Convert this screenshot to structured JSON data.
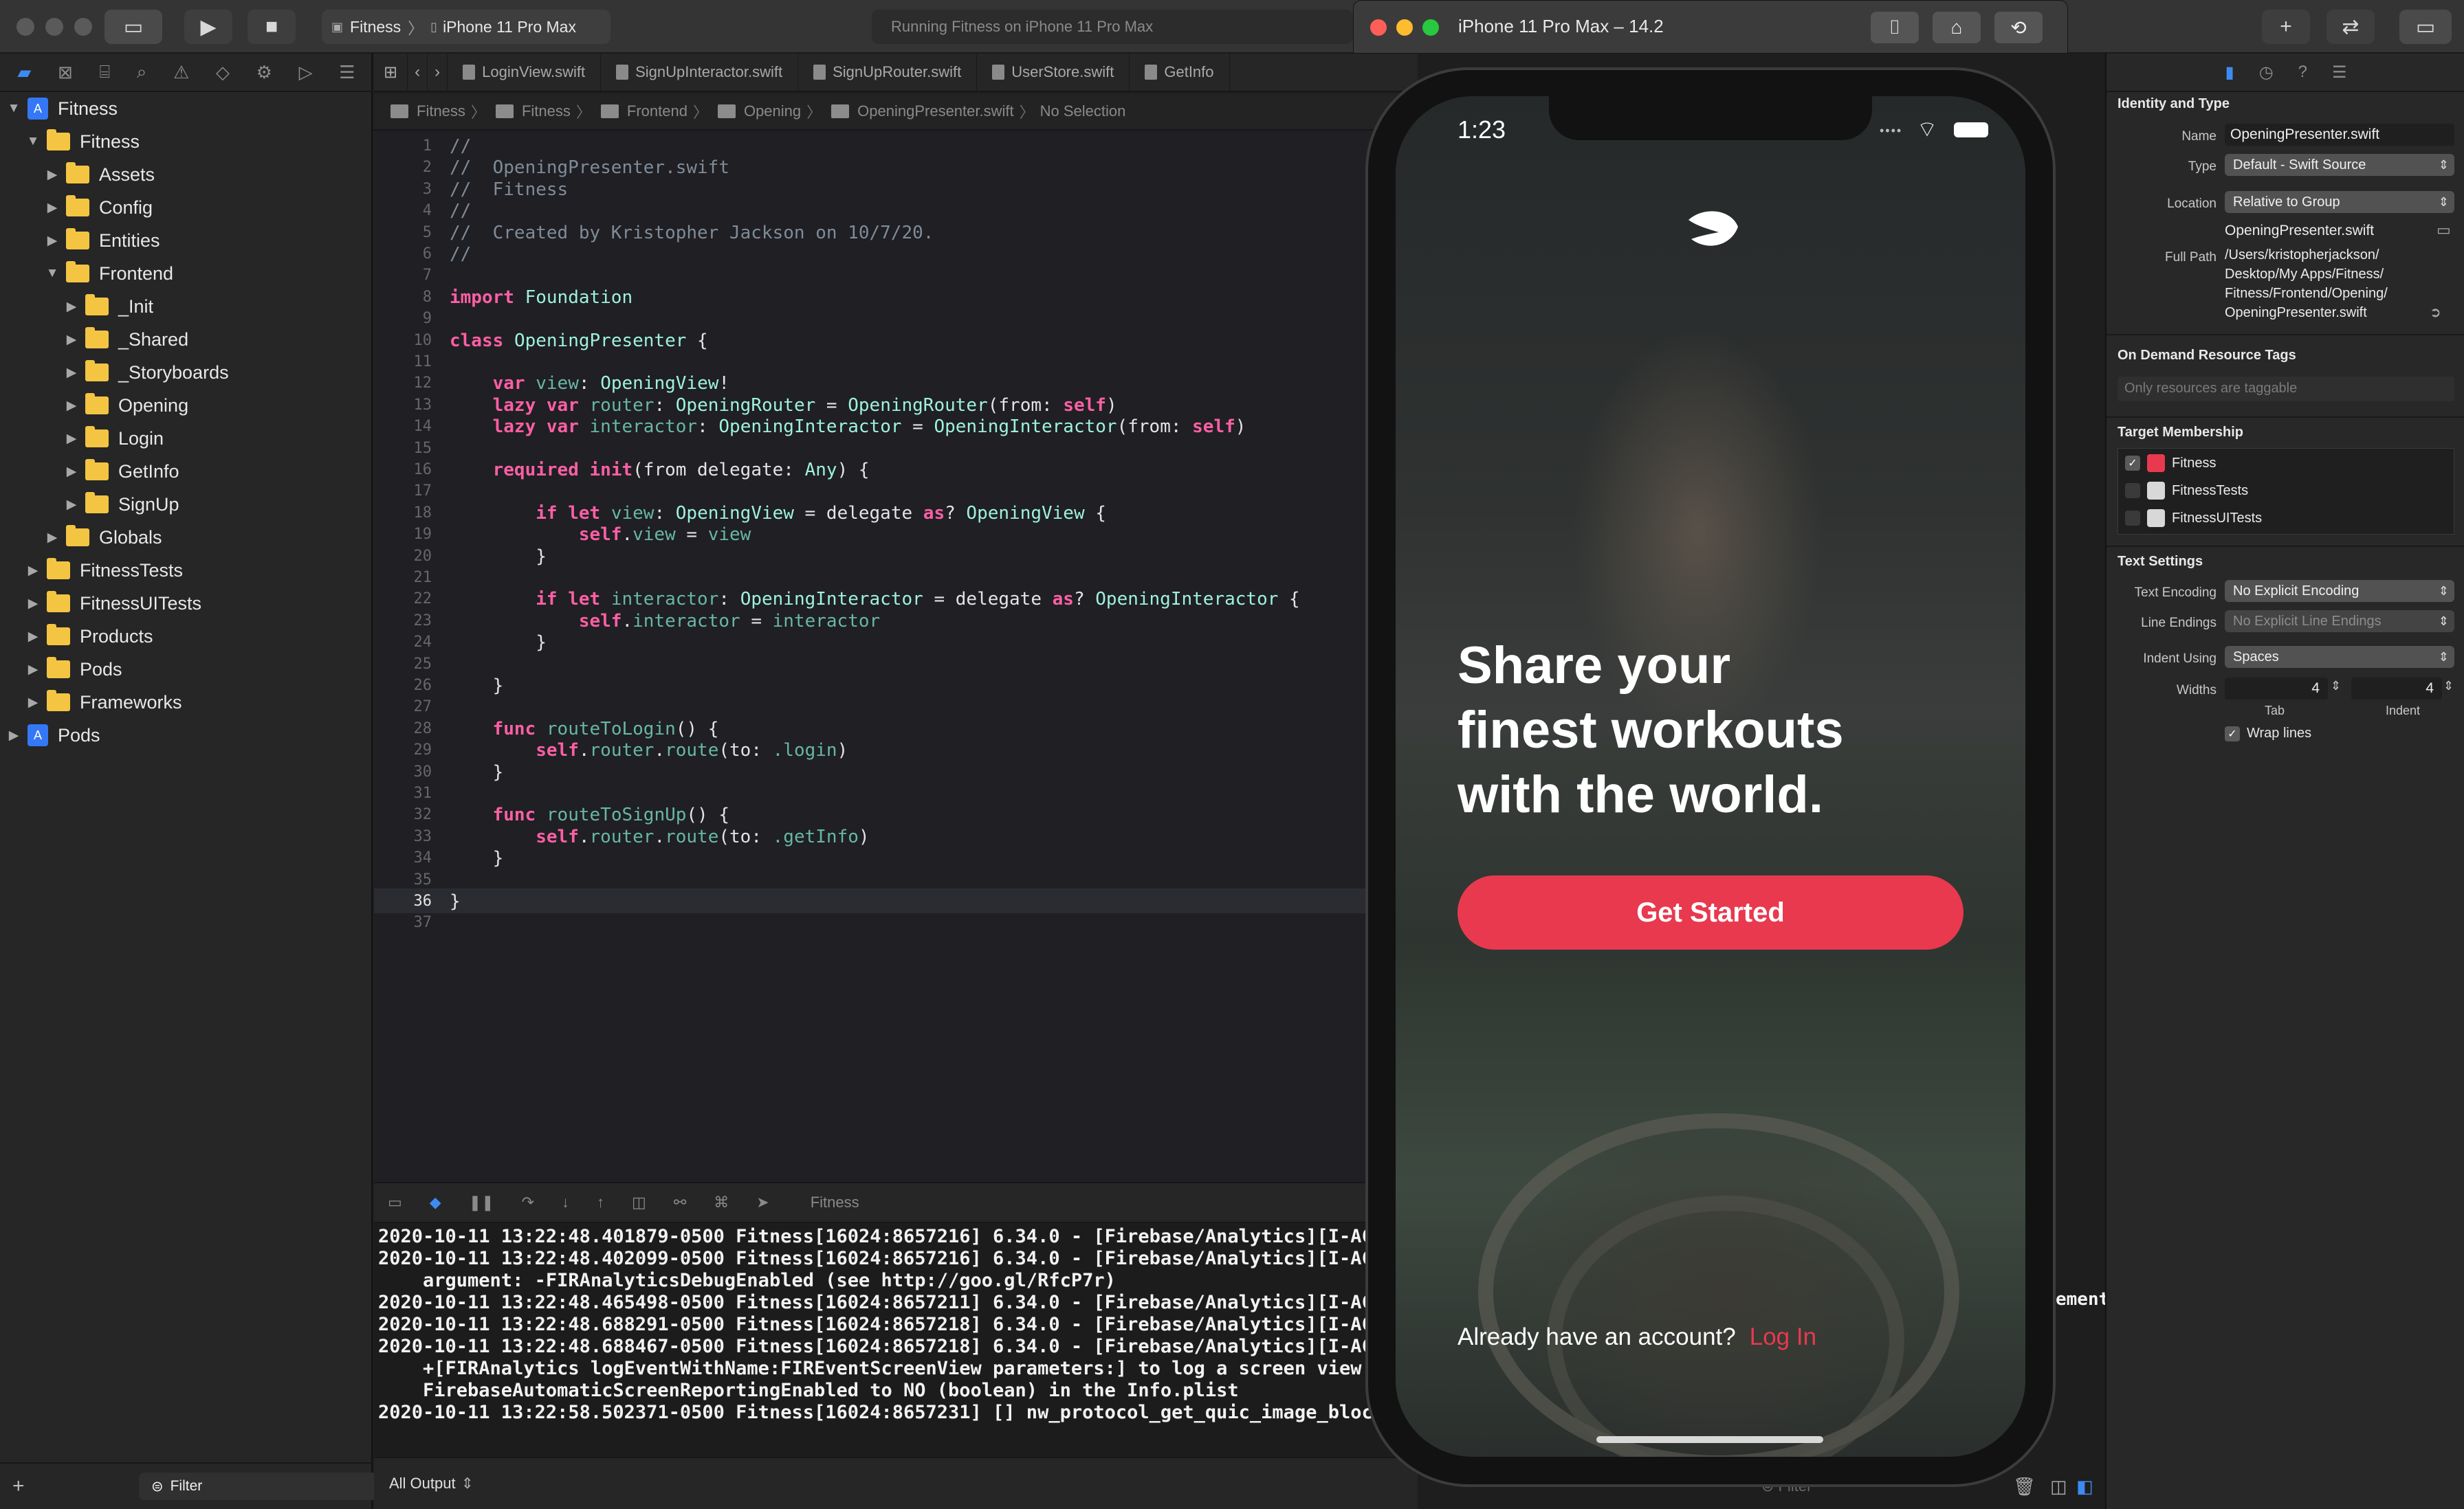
{
  "titlebar": {
    "scheme_project": "Fitness",
    "scheme_device": "iPhone 11 Pro Max",
    "activity": "Running Fitness on iPhone 11 Pro Max"
  },
  "simulator": {
    "window_title": "iPhone 11 Pro Max – 14.2",
    "status_time": "1:23",
    "headline": [
      "Share your",
      "finest workouts",
      "with the world."
    ],
    "cta_label": "Get Started",
    "prompt_text": "Already have an account?",
    "login_link": "Log In",
    "accent_color": "#e8394f"
  },
  "navigator": {
    "items": [
      {
        "label": "Fitness",
        "indent": 0,
        "open": true,
        "kind": "project"
      },
      {
        "label": "Fitness",
        "indent": 1,
        "open": true,
        "kind": "folder"
      },
      {
        "label": "Assets",
        "indent": 2,
        "open": false,
        "kind": "folder"
      },
      {
        "label": "Config",
        "indent": 2,
        "open": false,
        "kind": "folder"
      },
      {
        "label": "Entities",
        "indent": 2,
        "open": false,
        "kind": "folder"
      },
      {
        "label": "Frontend",
        "indent": 2,
        "open": true,
        "kind": "folder"
      },
      {
        "label": "_Init",
        "indent": 3,
        "open": false,
        "kind": "folder"
      },
      {
        "label": "_Shared",
        "indent": 3,
        "open": false,
        "kind": "folder"
      },
      {
        "label": "_Storyboards",
        "indent": 3,
        "open": false,
        "kind": "folder"
      },
      {
        "label": "Opening",
        "indent": 3,
        "open": false,
        "kind": "folder"
      },
      {
        "label": "Login",
        "indent": 3,
        "open": false,
        "kind": "folder"
      },
      {
        "label": "GetInfo",
        "indent": 3,
        "open": false,
        "kind": "folder"
      },
      {
        "label": "SignUp",
        "indent": 3,
        "open": false,
        "kind": "folder"
      },
      {
        "label": "Globals",
        "indent": 2,
        "open": false,
        "kind": "folder"
      },
      {
        "label": "FitnessTests",
        "indent": 1,
        "open": false,
        "kind": "folder"
      },
      {
        "label": "FitnessUITests",
        "indent": 1,
        "open": false,
        "kind": "folder"
      },
      {
        "label": "Products",
        "indent": 1,
        "open": false,
        "kind": "folder"
      },
      {
        "label": "Pods",
        "indent": 1,
        "open": false,
        "kind": "folder"
      },
      {
        "label": "Frameworks",
        "indent": 1,
        "open": false,
        "kind": "folder"
      },
      {
        "label": "Pods",
        "indent": 0,
        "open": false,
        "kind": "project"
      }
    ],
    "filter_placeholder": "Filter"
  },
  "editor": {
    "tabs": [
      "LoginView.swift",
      "SignUpInteractor.swift",
      "SignUpRouter.swift",
      "UserStore.swift",
      "GetInfo"
    ],
    "breadcrumb": [
      "Fitness",
      "Fitness",
      "Frontend",
      "Opening",
      "OpeningPresenter.swift",
      "No Selection"
    ],
    "current_line": 36,
    "lines": [
      "//",
      "//  OpeningPresenter.swift",
      "//  Fitness",
      "//",
      "//  Created by Kristopher Jackson on 10/7/20.",
      "//",
      "",
      "import Foundation",
      "",
      "class OpeningPresenter {",
      "",
      "    var view: OpeningView!",
      "    lazy var router: OpeningRouter = OpeningRouter(from: self)",
      "    lazy var interactor: OpeningInteractor = OpeningInteractor(from: self)",
      "",
      "    required init(from delegate: Any) {",
      "",
      "        if let view: OpeningView = delegate as? OpeningView {",
      "            self.view = view",
      "        }",
      "",
      "        if let interactor: OpeningInteractor = delegate as? OpeningInteractor {",
      "            self.interactor = interactor",
      "        }",
      "",
      "    }",
      "",
      "    func routeToLogin() {",
      "        self.router.route(to: .login)",
      "    }",
      "",
      "    func routeToSignUp() {",
      "        self.router.route(to: .getInfo)",
      "    }",
      "",
      "}",
      ""
    ]
  },
  "debug": {
    "scope_label": "Fitness",
    "console": [
      "2020-10-11 13:22:48.401879-0500 Fitness[16024:8657216] 6.34.0 - [Firebase/Analytics][I-ACS",
      "2020-10-11 13:22:48.402099-0500 Fitness[16024:8657216] 6.34.0 - [Firebase/Analytics][I-ACS",
      "    argument: -FIRAnalyticsDebugEnabled (see http://goo.gl/RfcP7r)",
      "2020-10-11 13:22:48.465498-0500 Fitness[16024:8657211] 6.34.0 - [Firebase/Analytics][I-ACS",
      "2020-10-11 13:22:48.688291-0500 Fitness[16024:8657218] 6.34.0 - [Firebase/Analytics][I-ACS",
      "2020-10-11 13:22:48.688467-0500 Fitness[16024:8657218] 6.34.0 - [Firebase/Analytics][I-ACS",
      "    +[FIRAnalytics logEventWithName:FIREventScreenView parameters:] to log a screen view e",
      "    FirebaseAutomaticScreenReportingEnabled to NO (boolean) in the Info.plist",
      "2020-10-11 13:22:58.502371-0500 Fitness[16024:8657231] [] nw_protocol_get_quic_image_block"
    ],
    "output_selector": "All Output",
    "right_fragment": "ement",
    "right_filter": "Filter"
  },
  "inspector": {
    "identity_title": "Identity and Type",
    "name_label": "Name",
    "name_value": "OpeningPresenter.swift",
    "type_label": "Type",
    "type_value": "Default - Swift Source",
    "location_label": "Location",
    "location_value": "Relative to Group",
    "location_file": "OpeningPresenter.swift",
    "fullpath_label": "Full Path",
    "fullpath_lines": [
      "/Users/kristopherjackson/",
      "Desktop/My Apps/Fitness/",
      "Fitness/Frontend/Opening/",
      "OpeningPresenter.swift"
    ],
    "odr_title": "On Demand Resource Tags",
    "odr_placeholder": "Only resources are taggable",
    "target_title": "Target Membership",
    "targets": [
      {
        "label": "Fitness",
        "checked": true
      },
      {
        "label": "FitnessTests",
        "checked": false
      },
      {
        "label": "FitnessUITests",
        "checked": false
      }
    ],
    "text_title": "Text Settings",
    "encoding_label": "Text Encoding",
    "encoding_value": "No Explicit Encoding",
    "endings_label": "Line Endings",
    "endings_value": "No Explicit Line Endings",
    "indent_label": "Indent Using",
    "indent_value": "Spaces",
    "widths_label": "Widths",
    "tab_width": "4",
    "indent_width": "4",
    "tab_caption": "Tab",
    "indent_caption": "Indent",
    "wrap_label": "Wrap lines"
  }
}
